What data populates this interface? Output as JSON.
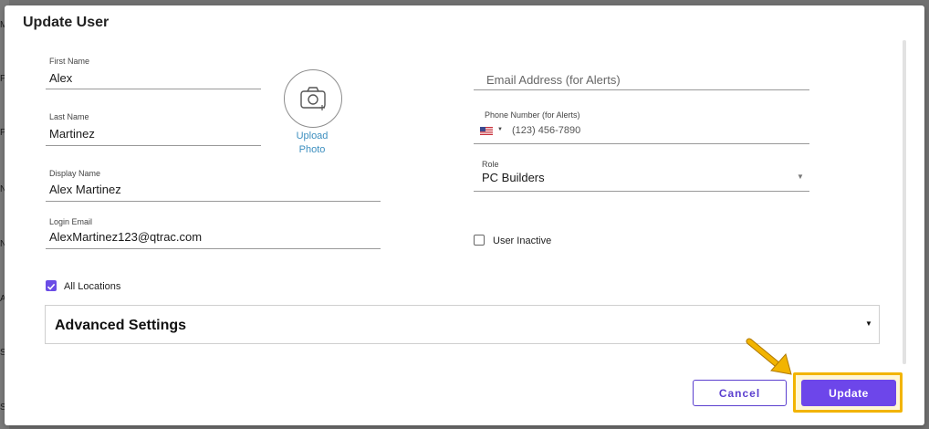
{
  "backdrop": {
    "letters": [
      "M",
      "P",
      "P",
      "N",
      "N",
      "A",
      "S",
      "S"
    ]
  },
  "modal": {
    "title": "Update User"
  },
  "form": {
    "first_name": {
      "label": "First Name",
      "value": "Alex"
    },
    "last_name": {
      "label": "Last Name",
      "value": "Martinez"
    },
    "display_name": {
      "label": "Display Name",
      "value": "Alex Martinez"
    },
    "login_email": {
      "label": "Login Email",
      "value": "AlexMartinez123@qtrac.com"
    },
    "email_alerts": {
      "placeholder": "Email Address (for Alerts)"
    },
    "phone_alerts": {
      "label": "Phone Number (for Alerts)",
      "placeholder": "(123) 456-7890",
      "country_icon": "us-flag-icon"
    },
    "role": {
      "label": "Role",
      "value": "PC Builders"
    },
    "user_inactive": {
      "label": "User Inactive",
      "checked": false
    },
    "all_locations": {
      "label": "All Locations",
      "checked": true
    }
  },
  "photo": {
    "icon": "camera-add-icon",
    "line1": "Upload",
    "line2": "Photo"
  },
  "advanced": {
    "title": "Advanced Settings"
  },
  "actions": {
    "cancel_label": "Cancel",
    "update_label": "Update"
  },
  "colors": {
    "accent": "#6d46ea",
    "highlight": "#f2b400",
    "link": "#3d8fbf"
  }
}
